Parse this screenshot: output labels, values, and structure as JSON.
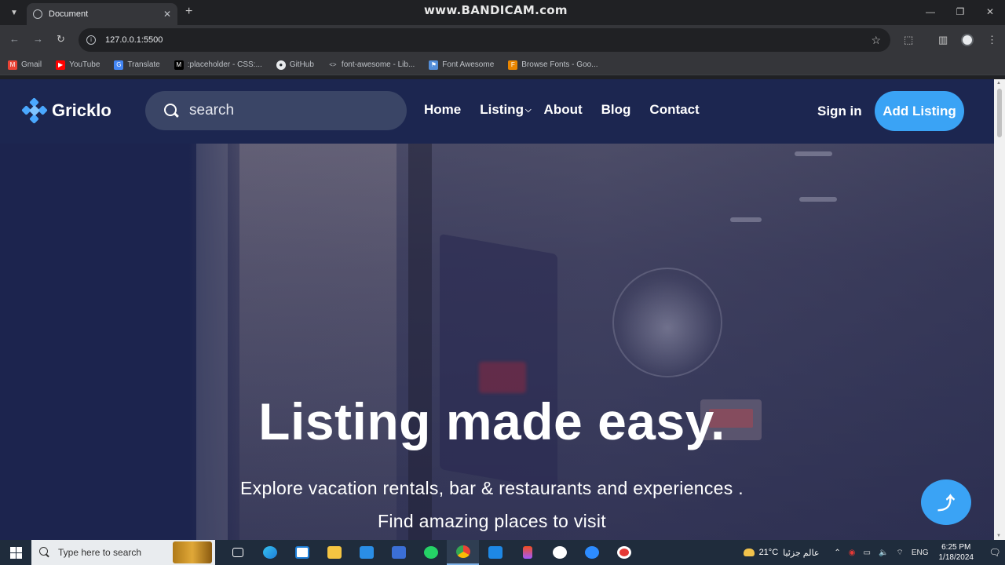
{
  "browser": {
    "tab_title": "Document",
    "watermark": "www.BANDICAM.com",
    "url": "127.0.0.1:5500",
    "bookmarks": [
      {
        "label": "Gmail",
        "color": "#ea4335"
      },
      {
        "label": "YouTube",
        "color": "#ff0000"
      },
      {
        "label": "Translate",
        "color": "#4285f4"
      },
      {
        "label": ":placeholder - CSS:...",
        "color": "#202124"
      },
      {
        "label": "GitHub",
        "color": "#24292e"
      },
      {
        "label": "font-awesome - Lib...",
        "color": "#555"
      },
      {
        "label": "Font Awesome",
        "color": "#538dd7"
      },
      {
        "label": "Browse Fonts - Goo...",
        "color": "#ea8600"
      }
    ]
  },
  "site": {
    "logo_text": "Gricklo",
    "search_placeholder": "search",
    "nav": {
      "home": "Home",
      "listing": "Listing",
      "about": "About",
      "blog": "Blog",
      "contact": "Contact"
    },
    "signin": "Sign in",
    "add_listing": "Add Listing",
    "accent_color": "#3aa3f5"
  },
  "hero": {
    "title": "Listing made easy.",
    "subtitle_1": "Explore vacation rentals, bar & restaurants and experiences .",
    "subtitle_2": "Find amazing places to visit"
  },
  "taskbar": {
    "search_placeholder": "Type here to search",
    "weather_temp": "21°C",
    "weather_text": "عالم جزئيا",
    "language": "ENG",
    "time": "6:25 PM",
    "date": "1/18/2024"
  }
}
